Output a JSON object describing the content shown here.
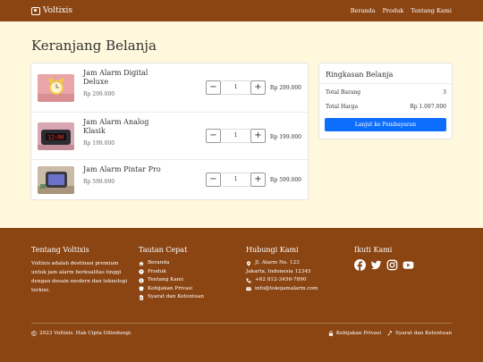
{
  "navbar": {
    "brand": "Voltixis",
    "links": [
      "Beranda",
      "Produk",
      "Tentang Kami"
    ]
  },
  "page": {
    "title": "Keranjang Belanja"
  },
  "cart": {
    "items": [
      {
        "name": "Jam Alarm Digital Deluxe",
        "price": "Rp 299.000",
        "qty": "1",
        "total": "Rp 299.000",
        "image": "pink-digital-alarm-clock"
      },
      {
        "name": "Jam Alarm Analog Klasik",
        "price": "Rp 199.000",
        "qty": "1",
        "total": "Rp 199.000",
        "image": "red-led-alarm-clock"
      },
      {
        "name": "Jam Alarm Pintar Pro",
        "price": "Rp 599.000",
        "qty": "1",
        "total": "Rp 599.000",
        "image": "smart-display-clock"
      }
    ],
    "minus_symbol": "−",
    "plus_symbol": "+"
  },
  "summary": {
    "title": "Ringkasan Belanja",
    "total_items_label": "Total Barang",
    "total_items_value": "3",
    "total_price_label": "Total Harga",
    "total_price_value": "Rp 1.097.000",
    "checkout_label": "Lanjut ke Pembayaran"
  },
  "footer": {
    "about_title": "Tentang Voltixis",
    "about_text": "Voltixis adalah destinasi premium untuk jam alarm berkualitas tinggi dengan desain modern dan teknologi terkini.",
    "links_title": "Tautan Cepat",
    "links": [
      "Beranda",
      "Produk",
      "Tentang Kami",
      "Kebijakan Privasi",
      "Syarat dan Ketentuan"
    ],
    "contact_title": "Hubungi Kami",
    "address": "Jl. Alarm No. 123",
    "city": "Jakarta, Indonesia 12345",
    "phone": "+62 812-3456-7890",
    "email": "info@tokojamalarm.com",
    "follow_title": "Ikuti Kami",
    "copyright": "2023 Voltixis. Hak Cipta Dilindungi.",
    "privacy": "Kebijakan Privasi",
    "terms": "Syarat dan Ketentuan"
  },
  "colors": {
    "brand": "#8B4513",
    "background": "#FFF8DC",
    "primary": "#0D6EFD"
  }
}
